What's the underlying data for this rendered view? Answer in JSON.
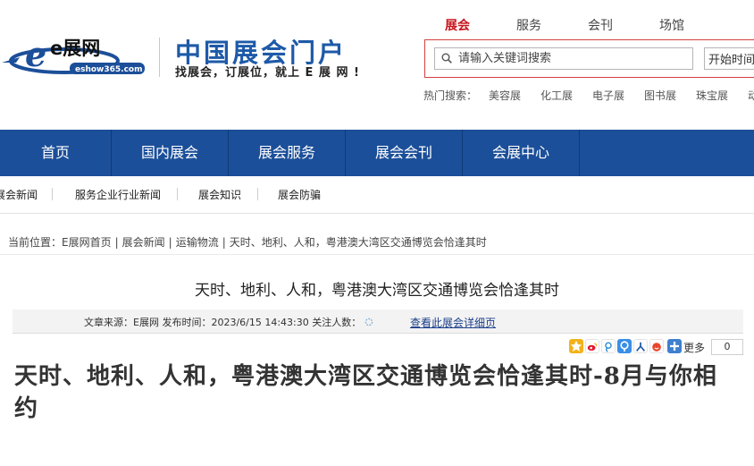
{
  "header": {
    "logo_text": "e展网",
    "logo_url_text": "eshow365.com",
    "portal_title": "中国展会门户",
    "portal_slogan": "找展会，订展位，就上 E 展 网 !"
  },
  "search": {
    "tabs": [
      "展会",
      "服务",
      "会刊",
      "场馆"
    ],
    "active_tab": "展会",
    "placeholder": "请输入关键词搜索",
    "start_time_label": "开始时间",
    "hot_label": "热门搜索：",
    "hot_items": [
      "美容展",
      "化工展",
      "电子展",
      "图书展",
      "珠宝展",
      "动"
    ]
  },
  "main_nav": {
    "items": [
      "首页",
      "国内展会",
      "展会服务",
      "展会会刊",
      "会展中心"
    ]
  },
  "sub_nav": {
    "items": [
      "展会新闻",
      "服务企业行业新闻",
      "展会知识",
      "展会防骗"
    ]
  },
  "breadcrumb": {
    "label": "当前位置：",
    "items": [
      "E展网首页",
      "展会新闻",
      "运输物流",
      "天时、地利、人和，粤港澳大湾区交通博览会恰逢其时"
    ]
  },
  "article": {
    "title": "天时、地利、人和，粤港澳大湾区交通博览会恰逢其时",
    "meta_source_label": "文章来源：",
    "meta_source": "E展网",
    "meta_time_label": "发布时间：",
    "meta_time": "2023/6/15 14:43:30",
    "meta_views_label": "关注人数：",
    "detail_link": "查看此展会详细页",
    "heading": "天时、地利、人和，粤港澳大湾区交通博览会恰逢其时-8月与你相约"
  },
  "share": {
    "more_label": "更多",
    "count": "0",
    "icons": [
      "qzone-icon",
      "weibo-icon",
      "tencent-weibo-icon",
      "pengyou-icon",
      "renren-icon",
      "kaixin-icon",
      "more-share-icon"
    ]
  },
  "colors": {
    "brand_blue": "#1c4f99",
    "accent_red": "#c8171e"
  }
}
